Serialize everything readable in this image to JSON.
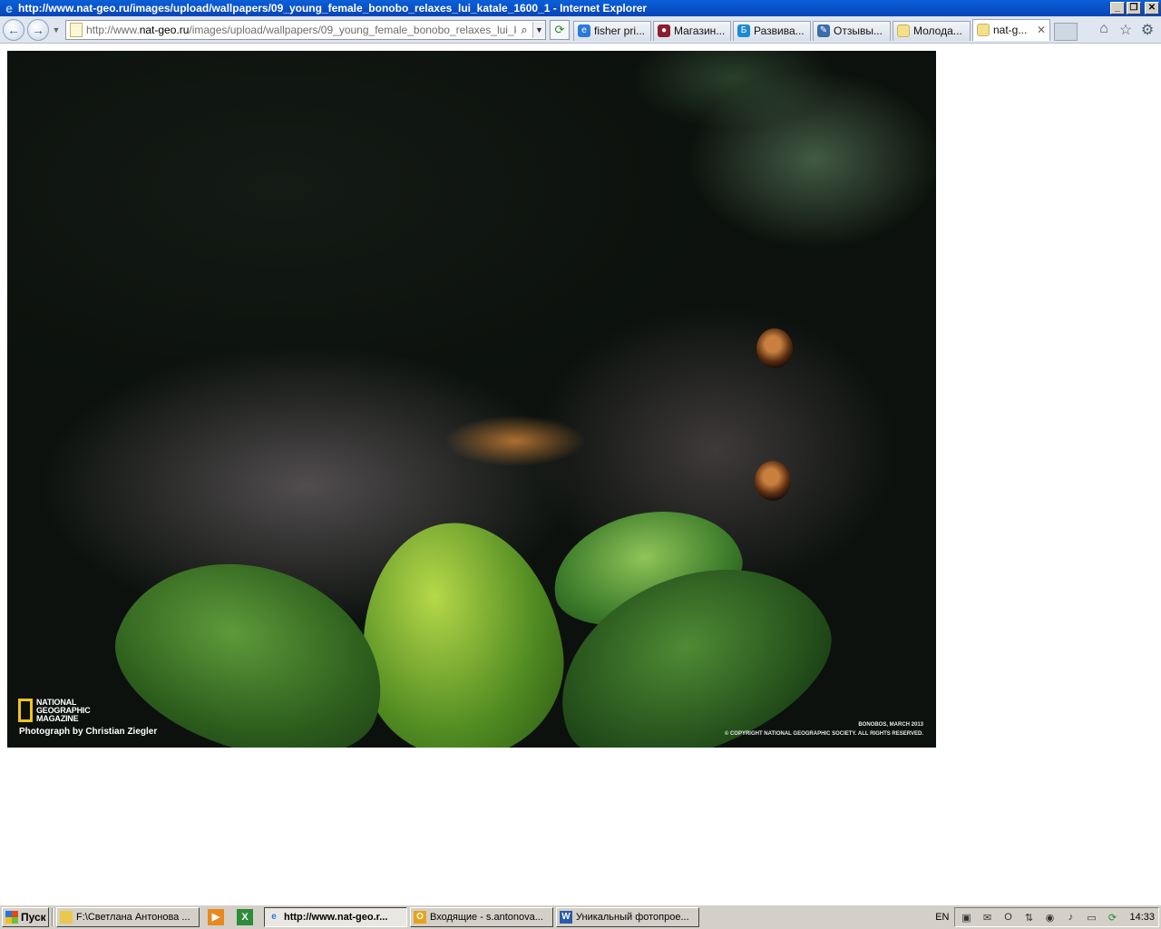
{
  "window": {
    "title": "http://www.nat-geo.ru/images/upload/wallpapers/09_young_female_bonobo_relaxes_lui_katale_1600_1 - Internet Explorer",
    "minimize": "_",
    "restore": "❐",
    "close": "✕"
  },
  "nav": {
    "address_domain_prefix": "http://www.",
    "address_domain": "nat-geo.ru",
    "address_path": "/images/upload/wallpapers/09_young_female_bonobo_relaxes_lui_katale_",
    "tabs": [
      {
        "label": "fisher pri...",
        "icon": "ie-icon",
        "color": "#2a7ad9"
      },
      {
        "label": "Магазин...",
        "icon": "shop-icon",
        "color": "#8a1f2c"
      },
      {
        "label": "Развива...",
        "icon": "b-icon",
        "color": "#1b8ad0"
      },
      {
        "label": "Отзывы...",
        "icon": "review-icon",
        "color": "#3b6ea8"
      },
      {
        "label": "Молода...",
        "icon": "page-icon",
        "color": "#f4e08a"
      },
      {
        "label": "nat-g...",
        "icon": "page-icon",
        "color": "#f4e08a",
        "active": true
      }
    ]
  },
  "photo": {
    "brand_lines": [
      "NATIONAL",
      "GEOGRAPHIC",
      "MAGAZINE"
    ],
    "credit": "Photograph by Christian Ziegler",
    "caption_line1": "BONOBOS, MARCH 2013",
    "caption_line2": "© COPYRIGHT NATIONAL GEOGRAPHIC SOCIETY. ALL RIGHTS RESERVED.",
    "brand_color": "#f2c418"
  },
  "taskbar": {
    "start_label": "Пуск",
    "tasks": [
      {
        "label": "F:\\Светлана Антонова ...",
        "icon": "folder-icon",
        "color": "#e9c84c"
      },
      {
        "label": "http://www.nat-geo.r...",
        "icon": "ie-icon",
        "color": "#2a7ad9",
        "active": true
      },
      {
        "label": "Входящие - s.antonova...",
        "icon": "outlook-icon",
        "color": "#e8a21a"
      },
      {
        "label": "Уникальный фотопрое...",
        "icon": "word-icon",
        "color": "#2a5ba8"
      }
    ],
    "language": "EN",
    "clock": "14:33"
  }
}
